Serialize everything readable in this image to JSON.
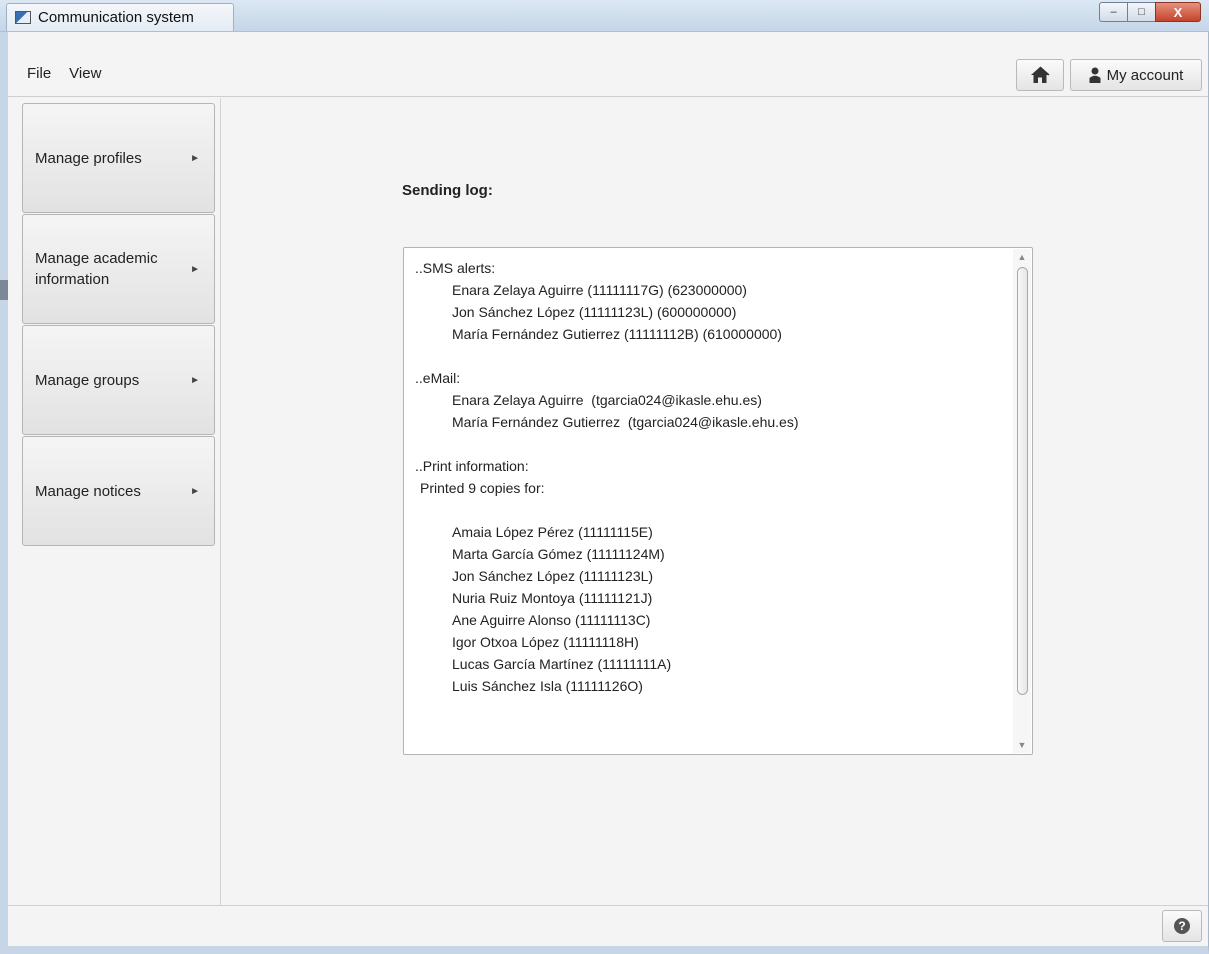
{
  "window": {
    "title": "Communication system",
    "controls": {
      "minimize": "–",
      "maximize": "□",
      "close": "X"
    }
  },
  "menu": {
    "items": [
      {
        "label": "File"
      },
      {
        "label": "View"
      }
    ],
    "account_label": "My account"
  },
  "sidebar": {
    "items": [
      {
        "label": "Manage profiles"
      },
      {
        "label": "Manage academic\ninformation"
      },
      {
        "label": "Manage groups"
      },
      {
        "label": "Manage notices"
      }
    ],
    "arrow": "►"
  },
  "main": {
    "title": "Sending log:",
    "log": {
      "sms_header": "..SMS alerts:",
      "sms": [
        "Enara Zelaya Aguirre (11111117G) (623000000)",
        "Jon Sánchez López (11111123L) (600000000)",
        "María Fernández Gutierrez (11111112B) (610000000)"
      ],
      "email_header": "..eMail:",
      "email": [
        "Enara Zelaya Aguirre  (tgarcia024@ikasle.ehu.es)",
        "María Fernández Gutierrez  (tgarcia024@ikasle.ehu.es)"
      ],
      "print_header": "..Print information:",
      "print_summary": "Printed 9 copies for:",
      "print": [
        "Amaia López Pérez (11111115E)",
        "Marta García Gómez (11111124M)",
        "Jon Sánchez López (11111123L)",
        "Nuria Ruiz Montoya (11111121J)",
        "Ane Aguirre Alonso (11111113C)",
        "Igor Otxoa López (11111118H)",
        "Lucas García Martínez (11111111A)",
        "Luis Sánchez Isla (11111126O)"
      ]
    }
  },
  "footer": {
    "help_label": "?"
  }
}
